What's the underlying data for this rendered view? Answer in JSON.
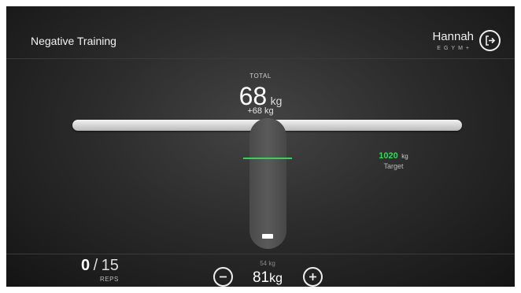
{
  "header": {
    "title": "Negative Training",
    "user_name": "Hannah",
    "brand": "EGYM+"
  },
  "total": {
    "label": "TOTAL",
    "value": "68",
    "unit": "kg",
    "delta": "+68 kg"
  },
  "target": {
    "value": "1020",
    "unit": "kg",
    "label": "Target"
  },
  "reps": {
    "current": "0",
    "separator": "/",
    "total": "15",
    "label": "REPS"
  },
  "weight": {
    "previous": "54 kg",
    "value": "81",
    "unit": "kg"
  },
  "colors": {
    "accent_green": "#2fd458",
    "background": "#2c2c2c"
  },
  "icons": {
    "exit": "logout-icon",
    "decrease": "minus-icon",
    "increase": "plus-icon"
  }
}
